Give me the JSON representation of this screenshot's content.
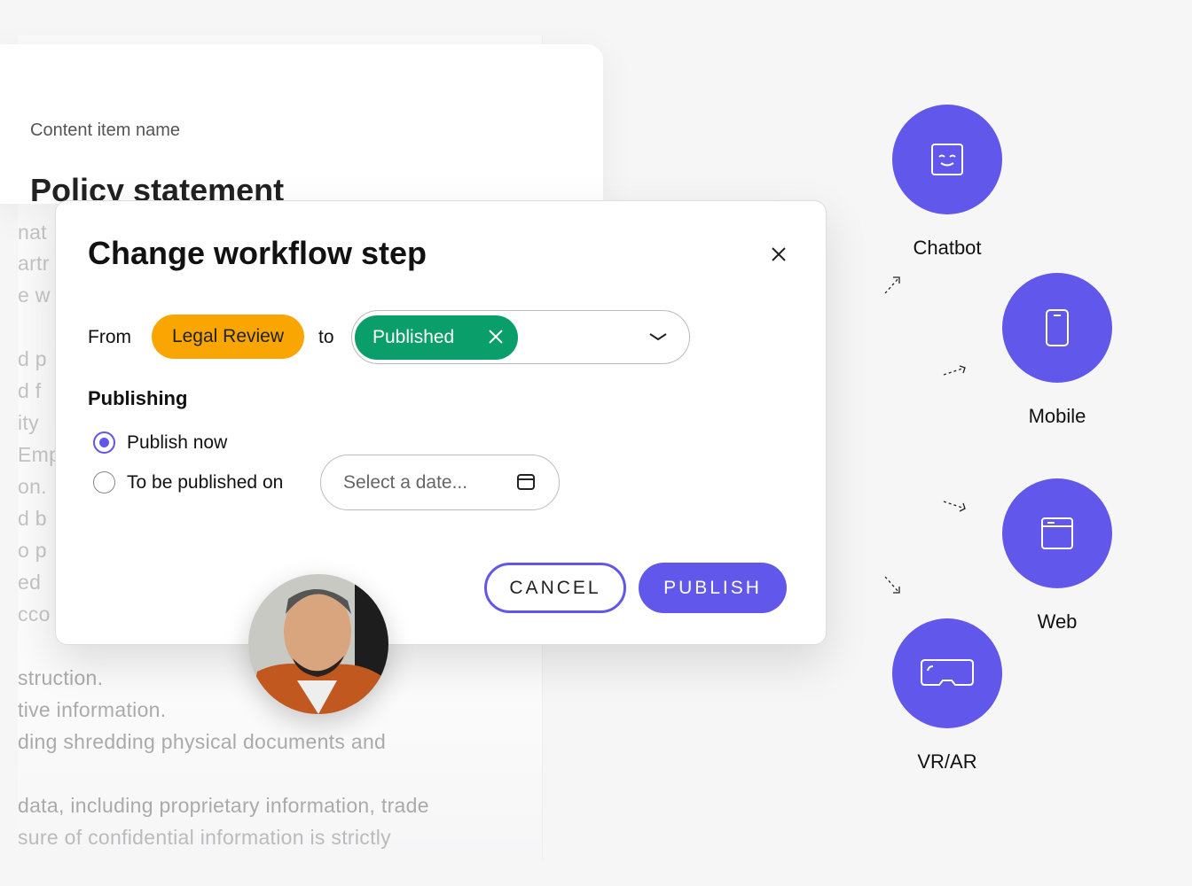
{
  "background_doc": {
    "fragments": [
      "nat",
      "artr",
      "e w",
      "d p",
      "d f",
      "ity",
      "Emp",
      "on.",
      "d b",
      "o p",
      "ed",
      "cco"
    ],
    "lines": [
      "struction.",
      "tive information.",
      "ding shredding physical documents and",
      "data, including proprietary information, trade",
      "sure of confidential information is strictly"
    ]
  },
  "content_card": {
    "label": "Content item name",
    "title": "Policy statement"
  },
  "modal": {
    "title": "Change workflow step",
    "from_label": "From",
    "from_status": "Legal Review",
    "to_label": "to",
    "to_status": "Published",
    "section_title": "Publishing",
    "options": [
      {
        "label": "Publish now",
        "selected": true
      },
      {
        "label": "To be published on",
        "selected": false
      }
    ],
    "date_placeholder": "Select a date...",
    "cancel_label": "CANCEL",
    "publish_label": "PUBLISH"
  },
  "channels": [
    {
      "label": "Chatbot",
      "icon": "chatbot-icon"
    },
    {
      "label": "Mobile",
      "icon": "mobile-icon"
    },
    {
      "label": "Web",
      "icon": "web-browser-icon"
    },
    {
      "label": "VR/AR",
      "icon": "vr-headset-icon"
    }
  ],
  "colors": {
    "accent": "#6157ea",
    "legal_review": "#f9a602",
    "published": "#0a9e6b"
  }
}
